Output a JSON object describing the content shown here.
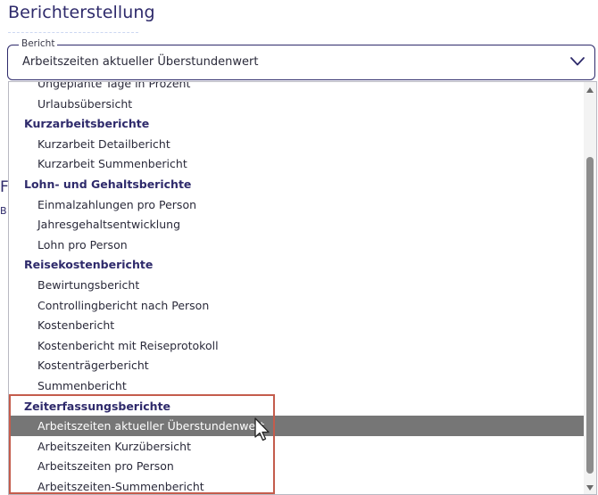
{
  "page": {
    "title": "Berichterstellung"
  },
  "report_select": {
    "legend": "Bericht",
    "value": "Arbeitszeiten aktueller Überstundenwert",
    "chevron_icon": "chevron-down-icon"
  },
  "dropdown": {
    "rows": [
      {
        "label": "Ungeplante Tage in Prozent",
        "kind": "item",
        "selected": false
      },
      {
        "label": "Urlaubsübersicht",
        "kind": "item",
        "selected": false
      },
      {
        "label": "Kurzarbeitsberichte",
        "kind": "header",
        "selected": false
      },
      {
        "label": "Kurzarbeit Detailbericht",
        "kind": "item",
        "selected": false
      },
      {
        "label": "Kurzarbeit Summenbericht",
        "kind": "item",
        "selected": false
      },
      {
        "label": "Lohn- und Gehaltsberichte",
        "kind": "header",
        "selected": false
      },
      {
        "label": "Einmalzahlungen pro Person",
        "kind": "item",
        "selected": false
      },
      {
        "label": "Jahresgehaltsentwicklung",
        "kind": "item",
        "selected": false
      },
      {
        "label": "Lohn pro Person",
        "kind": "item",
        "selected": false
      },
      {
        "label": "Reisekostenberichte",
        "kind": "header",
        "selected": false
      },
      {
        "label": "Bewirtungsbericht",
        "kind": "item",
        "selected": false
      },
      {
        "label": "Controllingbericht nach Person",
        "kind": "item",
        "selected": false
      },
      {
        "label": "Kostenbericht",
        "kind": "item",
        "selected": false
      },
      {
        "label": "Kostenbericht mit Reiseprotokoll",
        "kind": "item",
        "selected": false
      },
      {
        "label": "Kostenträgerbericht",
        "kind": "item",
        "selected": false
      },
      {
        "label": "Summenbericht",
        "kind": "item",
        "selected": false
      },
      {
        "label": "Zeiterfassungsberichte",
        "kind": "header",
        "selected": false
      },
      {
        "label": "Arbeitszeiten aktueller Überstundenwert",
        "kind": "item",
        "selected": true
      },
      {
        "label": "Arbeitszeiten Kurzübersicht",
        "kind": "item",
        "selected": false
      },
      {
        "label": "Arbeitszeiten pro Person",
        "kind": "item",
        "selected": false
      },
      {
        "label": "Arbeitszeiten-Summenbericht",
        "kind": "item",
        "selected": false
      }
    ]
  },
  "colors": {
    "brand": "#2e2a6b",
    "selection": "#767676",
    "highlight_frame": "#c45c4c"
  }
}
